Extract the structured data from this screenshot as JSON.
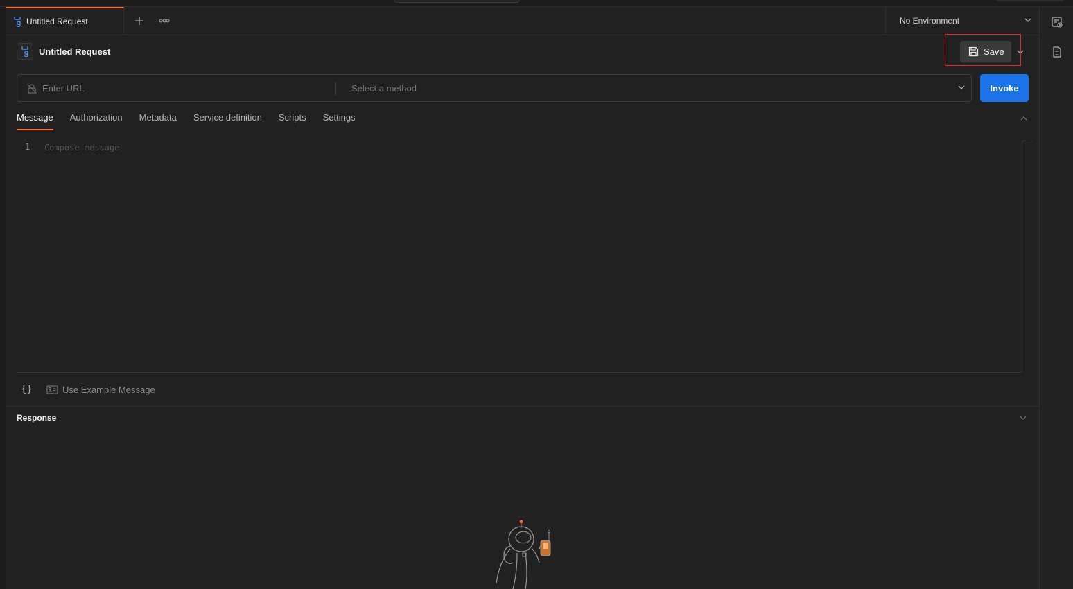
{
  "tabs": [
    {
      "label": "Untitled Request"
    }
  ],
  "environment": {
    "selected": "No Environment"
  },
  "request": {
    "title": "Untitled Request",
    "save_label": "Save",
    "url_placeholder": "Enter URL",
    "method_placeholder": "Select a method",
    "invoke_label": "Invoke"
  },
  "subtabs": [
    {
      "label": "Message"
    },
    {
      "label": "Authorization"
    },
    {
      "label": "Metadata"
    },
    {
      "label": "Service definition"
    },
    {
      "label": "Scripts"
    },
    {
      "label": "Settings"
    }
  ],
  "editor": {
    "line_number": "1",
    "placeholder": "Compose message"
  },
  "message_tools": {
    "braces": "{}",
    "example_label": "Use Example Message"
  },
  "response": {
    "title": "Response"
  },
  "colors": {
    "accent": "#ff6c37",
    "invoke": "#1a73e8",
    "highlight": "#e0262c",
    "background": "#212121"
  }
}
